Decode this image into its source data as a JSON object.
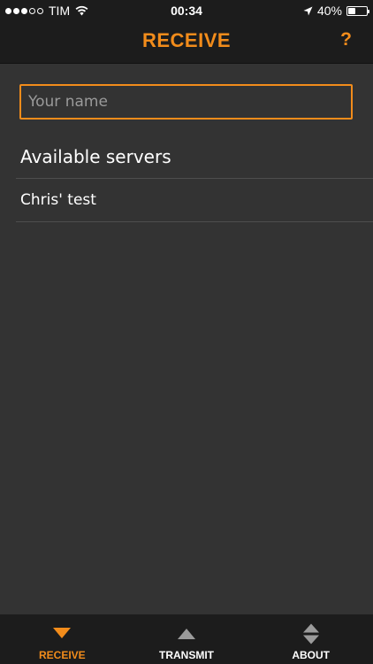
{
  "status_bar": {
    "carrier": "TIM",
    "time": "00:34",
    "battery": "40%",
    "signal_bars_filled": 3,
    "signal_bars_total": 5,
    "battery_level": 0.4
  },
  "nav": {
    "title": "RECEIVE",
    "help_label": "?"
  },
  "form": {
    "name_placeholder": "Your name",
    "name_value": ""
  },
  "servers": {
    "heading": "Available servers",
    "items": [
      {
        "label": "Chris' test"
      }
    ]
  },
  "tabs": [
    {
      "label": "RECEIVE",
      "icon": "triangle-down-icon",
      "active": true
    },
    {
      "label": "TRANSMIT",
      "icon": "triangle-up-icon",
      "active": false
    },
    {
      "label": "ABOUT",
      "icon": "up-down-arrows-icon",
      "active": false
    }
  ],
  "colors": {
    "accent": "#f28c1b",
    "background": "#333333",
    "bar": "#1c1c1c",
    "inactive_icon": "#9b9b9b"
  }
}
